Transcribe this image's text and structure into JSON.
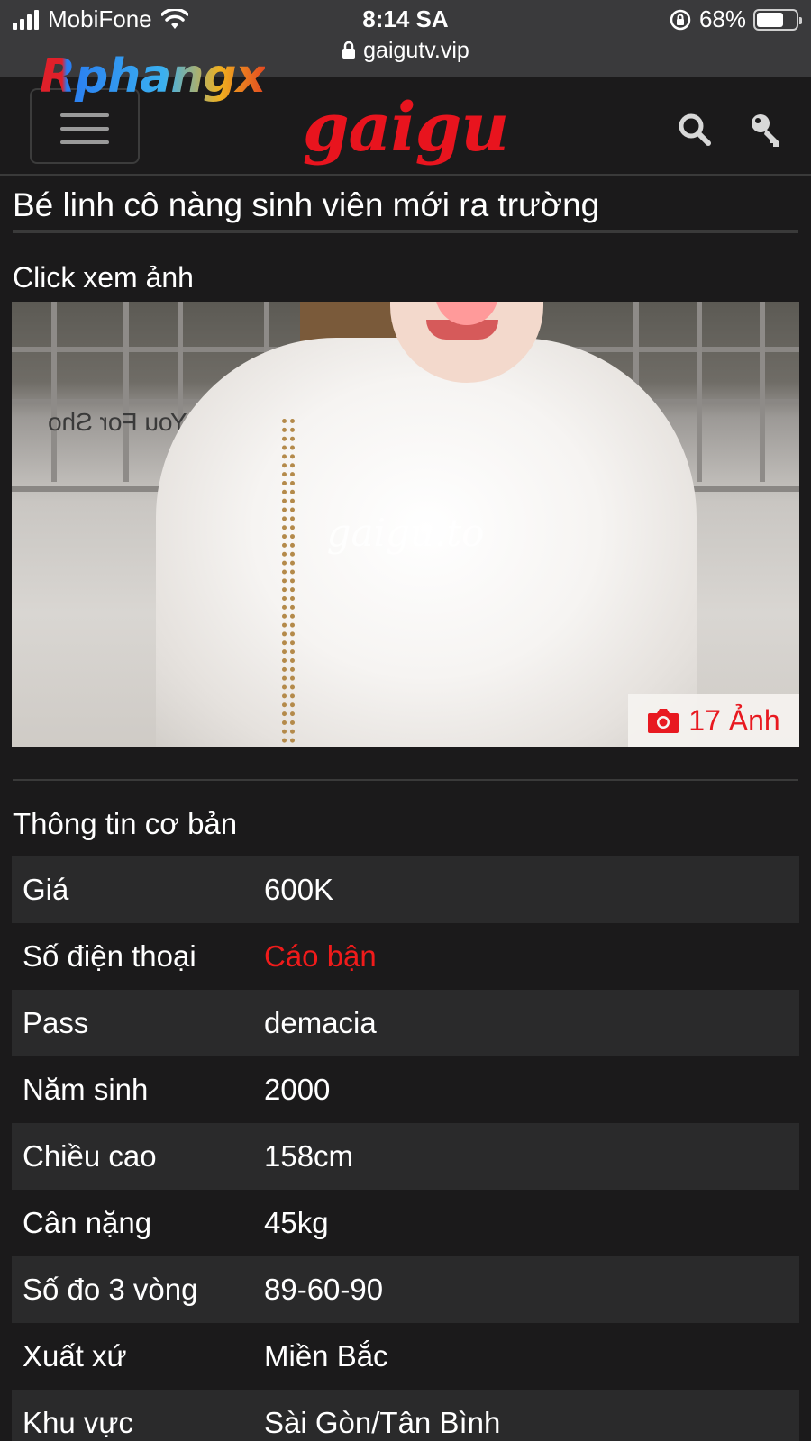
{
  "status_bar": {
    "carrier": "MobiFone",
    "time": "8:14 SA",
    "url": "gaigutv.vip",
    "battery_percent": "68%",
    "battery_level": 0.68
  },
  "header": {
    "logo": "gaigu",
    "overlay_watermark": "Rphangx"
  },
  "post": {
    "title": "Bé linh cô nàng sinh viên mới ra trường",
    "click_label": "Click xem ảnh",
    "photo_watermark": "gaigu.to",
    "photo_banner_text": "Thank You For Sho",
    "photo_count": "17 Ảnh"
  },
  "info": {
    "section_title": "Thông tin cơ bản",
    "rows": [
      {
        "label": "Giá",
        "value": "600K"
      },
      {
        "label": "Số điện thoại",
        "value": "Cáo bận"
      },
      {
        "label": "Pass",
        "value": "demacia"
      },
      {
        "label": "Năm sinh",
        "value": "2000"
      },
      {
        "label": "Chiều cao",
        "value": "158cm"
      },
      {
        "label": "Cân nặng",
        "value": "45kg"
      },
      {
        "label": "Số đo 3 vòng",
        "value": "89-60-90"
      },
      {
        "label": "Xuất xứ",
        "value": "Miền Bắc"
      },
      {
        "label": "Khu vực",
        "value": "Sài Gòn/Tân Bình"
      }
    ]
  },
  "colors": {
    "accent_red": "#e8141e",
    "background": "#1b1a1b",
    "row_alt": "#2a2a2b"
  },
  "icons": [
    "signal-icon",
    "wifi-icon",
    "lock-icon",
    "orientation-lock-icon",
    "battery-icon",
    "hamburger-menu-icon",
    "search-icon",
    "key-icon",
    "camera-icon"
  ]
}
